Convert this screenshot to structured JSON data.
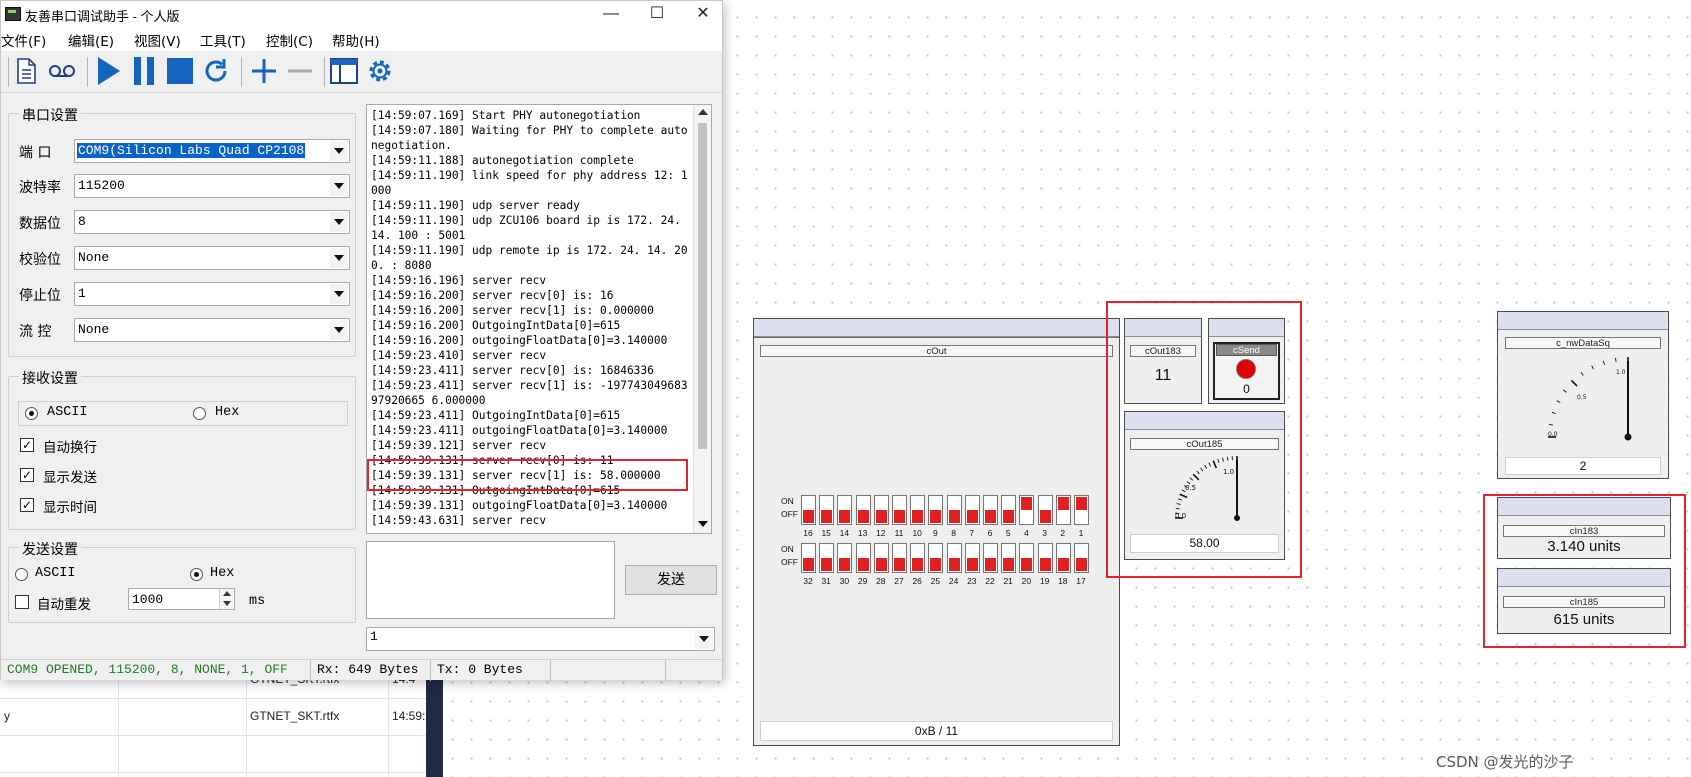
{
  "app": {
    "title": "友善串口调试助手 - 个人版",
    "window_buttons": {
      "minimize": "—",
      "maximize": "☐",
      "close": "✕"
    },
    "menu": [
      "文件(F)",
      "编辑(E)",
      "视图(V)",
      "工具(T)",
      "控制(C)",
      "帮助(H)"
    ],
    "toolbar_icons": [
      "document-icon",
      "record-icon",
      "play-icon",
      "pause-icon",
      "stop-icon",
      "refresh-icon",
      "plus-icon",
      "minus-icon",
      "window-icon",
      "gear-icon"
    ],
    "serial_settings": {
      "title": "串口设置",
      "port_label": "端  口",
      "port_value": "COM9(Silicon Labs Quad CP2108",
      "baud_label": "波特率",
      "baud_value": "115200",
      "databits_label": "数据位",
      "databits_value": "8",
      "parity_label": "校验位",
      "parity_value": "None",
      "stopbits_label": "停止位",
      "stopbits_value": "1",
      "flow_label": "流  控",
      "flow_value": "None"
    },
    "receive_settings": {
      "title": "接收设置",
      "ascii_label": "ASCII",
      "hex_label": "Hex",
      "mode": "ASCII",
      "auto_wrap_label": "自动换行",
      "auto_wrap": true,
      "show_send_label": "显示发送",
      "show_send": true,
      "show_time_label": "显示时间",
      "show_time": true
    },
    "send_settings": {
      "title": "发送设置",
      "ascii_label": "ASCII",
      "hex_label": "Hex",
      "mode": "Hex",
      "auto_resend_label": "自动重发",
      "auto_resend": false,
      "interval_value": "1000",
      "interval_unit": "ms"
    },
    "log_text": "[14:59:07.169] Start PHY autonegotiation\n[14:59:07.180] Waiting for PHY to complete autonegotiation.\n[14:59:11.188] autonegotiation complete\n[14:59:11.190] link speed for phy address 12: 1000\n[14:59:11.190] udp server ready\n[14:59:11.190] udp ZCU106 board ip is 172. 24. 14. 100 : 5001\n[14:59:11.190] udp remote ip is 172. 24. 14. 200. : 8080\n[14:59:16.196] server recv\n[14:59:16.200] server recv[0] is: 16\n[14:59:16.200] server recv[1] is: 0.000000\n[14:59:16.200] OutgoingIntData[0]=615\n[14:59:16.200] outgoingFloatData[0]=3.140000\n[14:59:23.410] server recv\n[14:59:23.411] server recv[0] is: 16846336\n[14:59:23.411] server recv[1] is: -19774304968397920665 6.000000\n[14:59:23.411] OutgoingIntData[0]=615\n[14:59:23.411] outgoingFloatData[0]=3.140000\n[14:59:39.121] server recv\n[14:59:39.131] server recv[0] is: 11\n[14:59:39.131] server recv[1] is: 58.000000\n[14:59:39.131] OutgoingIntData[0]=615\n[14:59:39.131] outgoingFloatData[0]=3.140000\n[14:59:43.631] server recv",
    "send_input_value": "1",
    "send_button_label": "发送",
    "status": {
      "port": "COM9 OPENED, 115200, 8, NONE, 1, OFF",
      "rx": "Rx: 649 Bytes",
      "tx": "Tx: 0 Bytes"
    }
  },
  "background_table": {
    "rows": [
      {
        "c1": "",
        "c2": "GTNET_SKT.rtfx",
        "c3": "14:4"
      },
      {
        "c1": "y",
        "c2": "GTNET_SKT.rtfx",
        "c3": "14:59:"
      }
    ]
  },
  "panels": {
    "cOut": {
      "label": "cOut",
      "switch_on": "ON",
      "switch_off": "OFF",
      "row1_numbers": [
        "16",
        "15",
        "14",
        "13",
        "12",
        "11",
        "10",
        "9",
        "8",
        "7",
        "6",
        "5",
        "4",
        "3",
        "2",
        "1"
      ],
      "row1_states": [
        0,
        0,
        0,
        0,
        0,
        0,
        0,
        0,
        0,
        0,
        0,
        0,
        1,
        0,
        1,
        1
      ],
      "row2_numbers": [
        "32",
        "31",
        "30",
        "29",
        "28",
        "27",
        "26",
        "25",
        "24",
        "23",
        "22",
        "21",
        "20",
        "19",
        "18",
        "17"
      ],
      "row2_states": [
        0,
        0,
        0,
        0,
        0,
        0,
        0,
        0,
        0,
        0,
        0,
        0,
        0,
        0,
        0,
        0
      ],
      "readout": "0xB / 11"
    },
    "cOut183": {
      "label": "cOut183",
      "value": "11"
    },
    "cSend": {
      "label": "cSend",
      "value": "0"
    },
    "cOut185": {
      "label": "cOut185",
      "ticks": [
        "0.0",
        "0.5",
        "1.0"
      ],
      "readout": "58.00",
      "needle_fraction": 1.0
    },
    "c_nwDataSq": {
      "label": "c_nwDataSq",
      "ticks": [
        "0.0",
        "0.5",
        "1.0"
      ],
      "readout": "2",
      "needle_fraction": 1.0
    },
    "cIn183": {
      "label": "cIn183",
      "value": "3.140 units"
    },
    "cIn185": {
      "label": "cIn185",
      "value": "615 units"
    }
  },
  "colors": {
    "highlight": "#e3242b",
    "switch_red": "#e12020",
    "panel_head": "#dcdfed",
    "status_green": "#1a7f1a",
    "play_blue": "#1565c0"
  },
  "watermark": "CSDN @发光的沙子"
}
